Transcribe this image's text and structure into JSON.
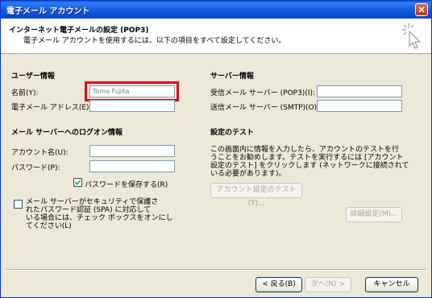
{
  "window": {
    "title": "電子メール アカウント"
  },
  "header": {
    "title": "インターネット電子メールの設定 (POP3)",
    "subtitle": "電子メール アカウントを使用するには、以下の項目をすべて設定してください。"
  },
  "user_info": {
    "section_title": "ユーザー情報",
    "name_label": "名前(Y):",
    "name_value": "Tomo Fujita",
    "email_label": "電子メール アドレス(E):",
    "email_value": ""
  },
  "server_info": {
    "section_title": "サーバー情報",
    "incoming_label": "受信メール サーバー (POP3)(I):",
    "incoming_value": "",
    "outgoing_label": "送信メール サーバー (SMTP)(O):",
    "outgoing_value": ""
  },
  "logon_info": {
    "section_title": "メール サーバーへのログオン情報",
    "account_label": "アカウント名(U):",
    "account_value": "",
    "password_label": "パスワード(P):",
    "password_value": "",
    "save_password_label": "パスワードを保存する(R)",
    "save_password_checked": true,
    "spa_lines": [
      "メール サーバーがセキュリティで保護さ",
      "れたパスワード認証 (SPA) に対応して",
      "いる場合には、チェック ボックスをオンにし",
      "てください(L)"
    ],
    "spa_checked": false
  },
  "test": {
    "section_title": "設定のテスト",
    "description_lines": [
      "この画面内に情報を入力したら、アカウントのテストを行",
      "うことをお勧めします。テストを実行するには [アカウント",
      "設定のテスト] をクリックします (ネットワークに接続されて",
      "いる必要があります)。"
    ],
    "test_button": "アカウント設定のテスト(T)..."
  },
  "advanced_button": "詳細設定(M)...",
  "footer": {
    "back_button": "< 戻る(B)",
    "next_button": "次へ(N) >",
    "cancel_button": "キャンセル"
  }
}
